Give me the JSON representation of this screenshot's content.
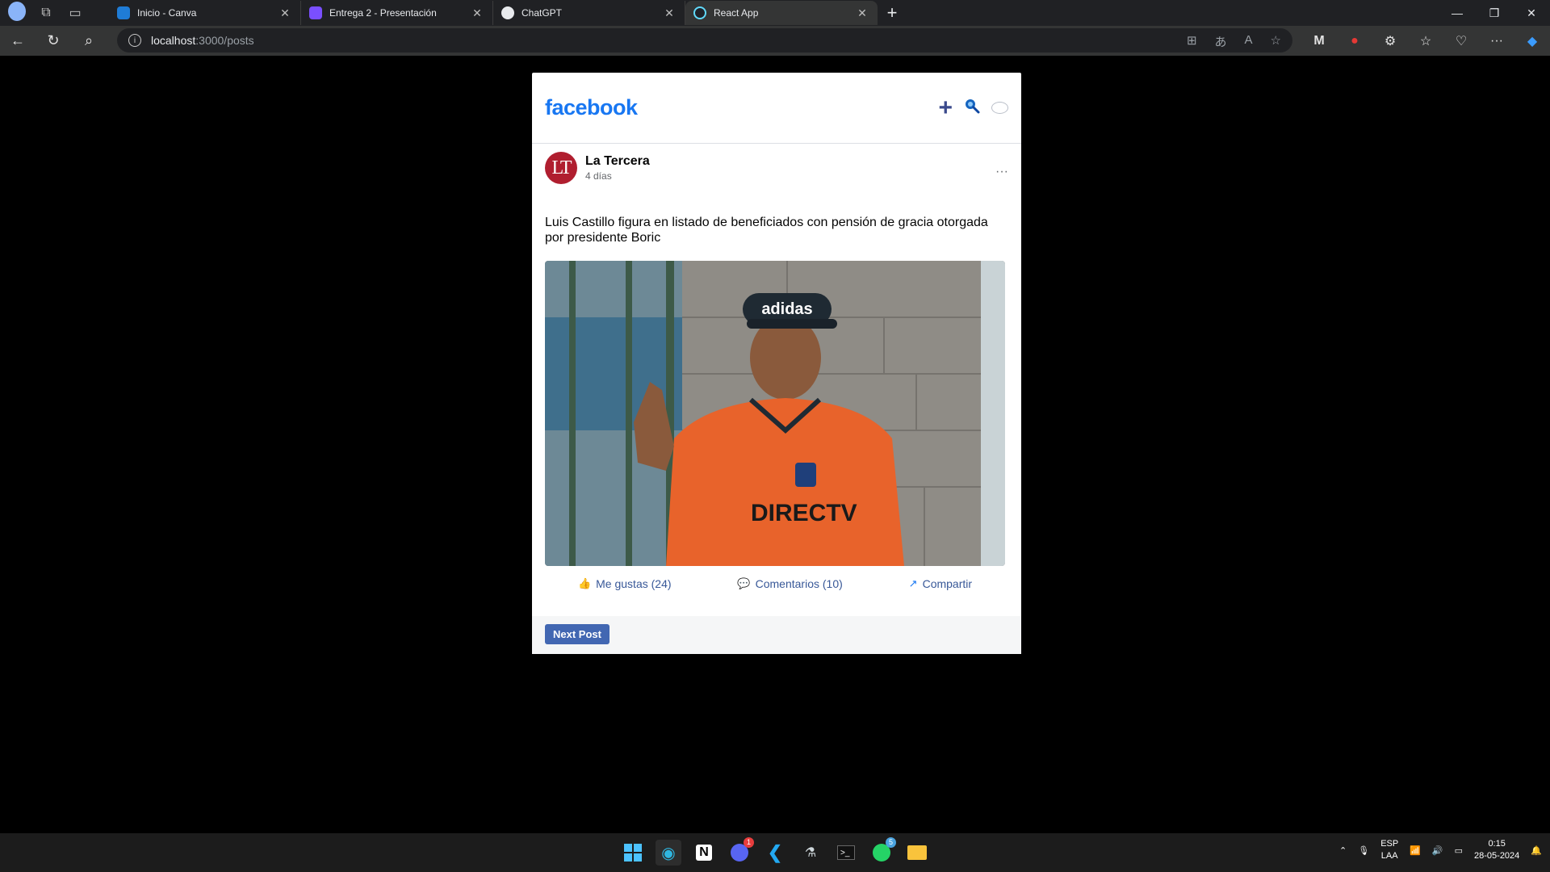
{
  "browser": {
    "tabs": [
      {
        "title": "Inicio - Canva",
        "favicon_color": "#1f7cd6",
        "active": false
      },
      {
        "title": "Entrega 2 - Presentación",
        "favicon_color": "#7a4fff",
        "active": false
      },
      {
        "title": "ChatGPT",
        "favicon_color": "#e8eaed",
        "active": false
      },
      {
        "title": "React App",
        "favicon_color": "#61dafb",
        "active": true
      }
    ],
    "url_host": "localhost",
    "url_path": ":3000/posts"
  },
  "feed": {
    "logo": "facebook",
    "post": {
      "author": "La Tercera",
      "avatar_initials": "LT",
      "time": "4 días",
      "more": "···",
      "text": "Luis Castillo figura en listado de beneficiados con pensión de gracia otorgada por presidente Boric",
      "image_text": "DIRECTV",
      "cap_text": "adidas"
    },
    "actions": {
      "like": "Me gustas (24)",
      "comment": "Comentarios (10)",
      "share": "Compartir"
    },
    "next_button": "Next Post"
  },
  "taskbar": {
    "badges": {
      "discord": "1",
      "whatsapp": "5"
    },
    "lang_top": "ESP",
    "lang_bottom": "LAA",
    "time": "0:15",
    "date": "28-05-2024"
  },
  "colors": {
    "brand": "#1877f2",
    "button": "#4267b2",
    "avatar": "#b01e2f"
  }
}
